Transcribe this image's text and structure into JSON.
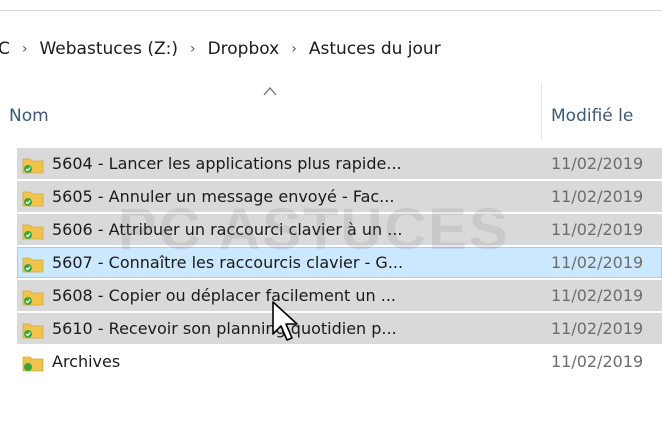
{
  "breadcrumb": {
    "items": [
      "C",
      "Webastuces (Z:)",
      "Dropbox",
      "Astuces du jour"
    ],
    "separator": "›"
  },
  "columns": {
    "name": "Nom",
    "modified": "Modifié le",
    "sort_icon": "chevron-up-icon"
  },
  "files": [
    {
      "name": "5604 - Lancer les applications plus rapide...",
      "date": "11/02/2019"
    },
    {
      "name": "5605 - Annuler un message envoyé - Fac...",
      "date": "11/02/2019"
    },
    {
      "name": "5606 - Attribuer un raccourci clavier à un ...",
      "date": "11/02/2019"
    },
    {
      "name": "5607 - Connaître les raccourcis clavier - G...",
      "date": "11/02/2019"
    },
    {
      "name": "5608 - Copier ou déplacer facilement un ...",
      "date": "11/02/2019"
    },
    {
      "name": "5610 - Recevoir son planning quotidien p...",
      "date": "11/02/2019"
    },
    {
      "name": "Archives",
      "date": "11/02/2019"
    }
  ],
  "watermark": "PC ASTUCES",
  "colors": {
    "row_highlight": "#d9d9d9",
    "row_selected": "#cce8ff",
    "header_text": "#3e5975",
    "folder": "#f0c44c",
    "sync_badge": "#3aa63a"
  }
}
